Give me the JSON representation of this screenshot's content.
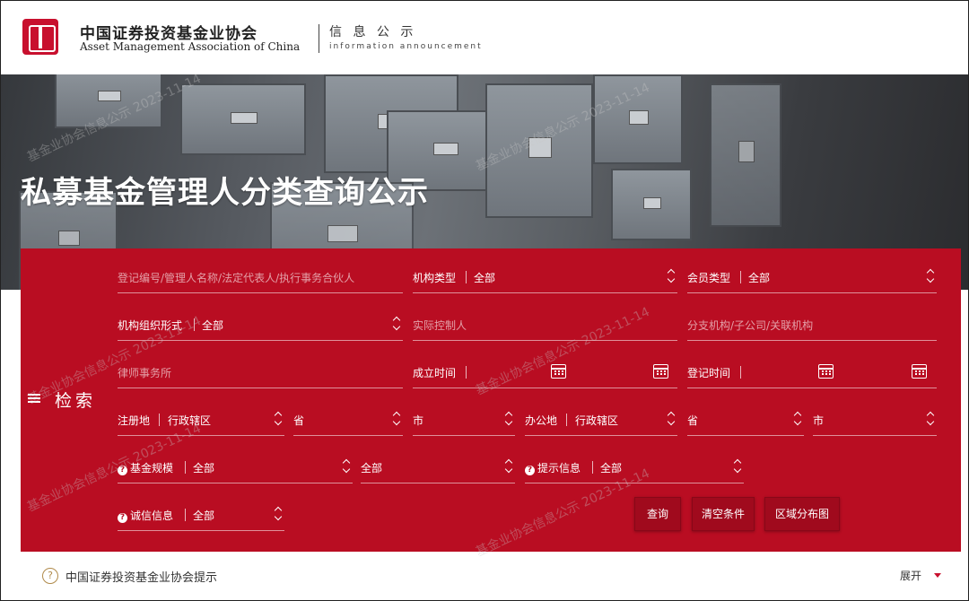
{
  "header": {
    "org_cn": "中国证券投资基金业协会",
    "org_en": "Asset Management Association of China",
    "section_cn": "信 息 公 示",
    "section_en": "information announcement"
  },
  "hero": {
    "title": "私募基金管理人分类查询公示"
  },
  "watermark": {
    "text": "基金业协会信息公示 2023-11-14"
  },
  "search": {
    "label": "检索",
    "keyword_placeholder": "登记编号/管理人名称/法定代表人/执行事务合伙人",
    "org_type": {
      "label": "机构类型",
      "value": "全部"
    },
    "member_type": {
      "label": "会员类型",
      "value": "全部"
    },
    "org_form": {
      "label": "机构组织形式",
      "value": "全部"
    },
    "controller_placeholder": "实际控制人",
    "branch_placeholder": "分支机构/子公司/关联机构",
    "law_firm_placeholder": "律师事务所",
    "established": {
      "label": "成立时间"
    },
    "registered": {
      "label": "登记时间"
    },
    "reg_place": {
      "label": "注册地",
      "district": "行政辖区",
      "province": "省",
      "city": "市"
    },
    "office_place": {
      "label": "办公地",
      "district": "行政辖区",
      "province": "省",
      "city": "市"
    },
    "fund_scale": {
      "label": "基金规模",
      "value": "全部",
      "value2": "全部"
    },
    "hint_info": {
      "label": "提示信息",
      "value": "全部"
    },
    "integrity": {
      "label": "诚信信息",
      "value": "全部"
    },
    "buttons": {
      "query": "查询",
      "clear": "清空条件",
      "map": "区域分布图"
    }
  },
  "footer": {
    "notice": "中国证券投资基金业协会提示",
    "expand": "展开"
  },
  "colors": {
    "brand_red": "#b90d22",
    "logo_red": "#c8102e"
  }
}
